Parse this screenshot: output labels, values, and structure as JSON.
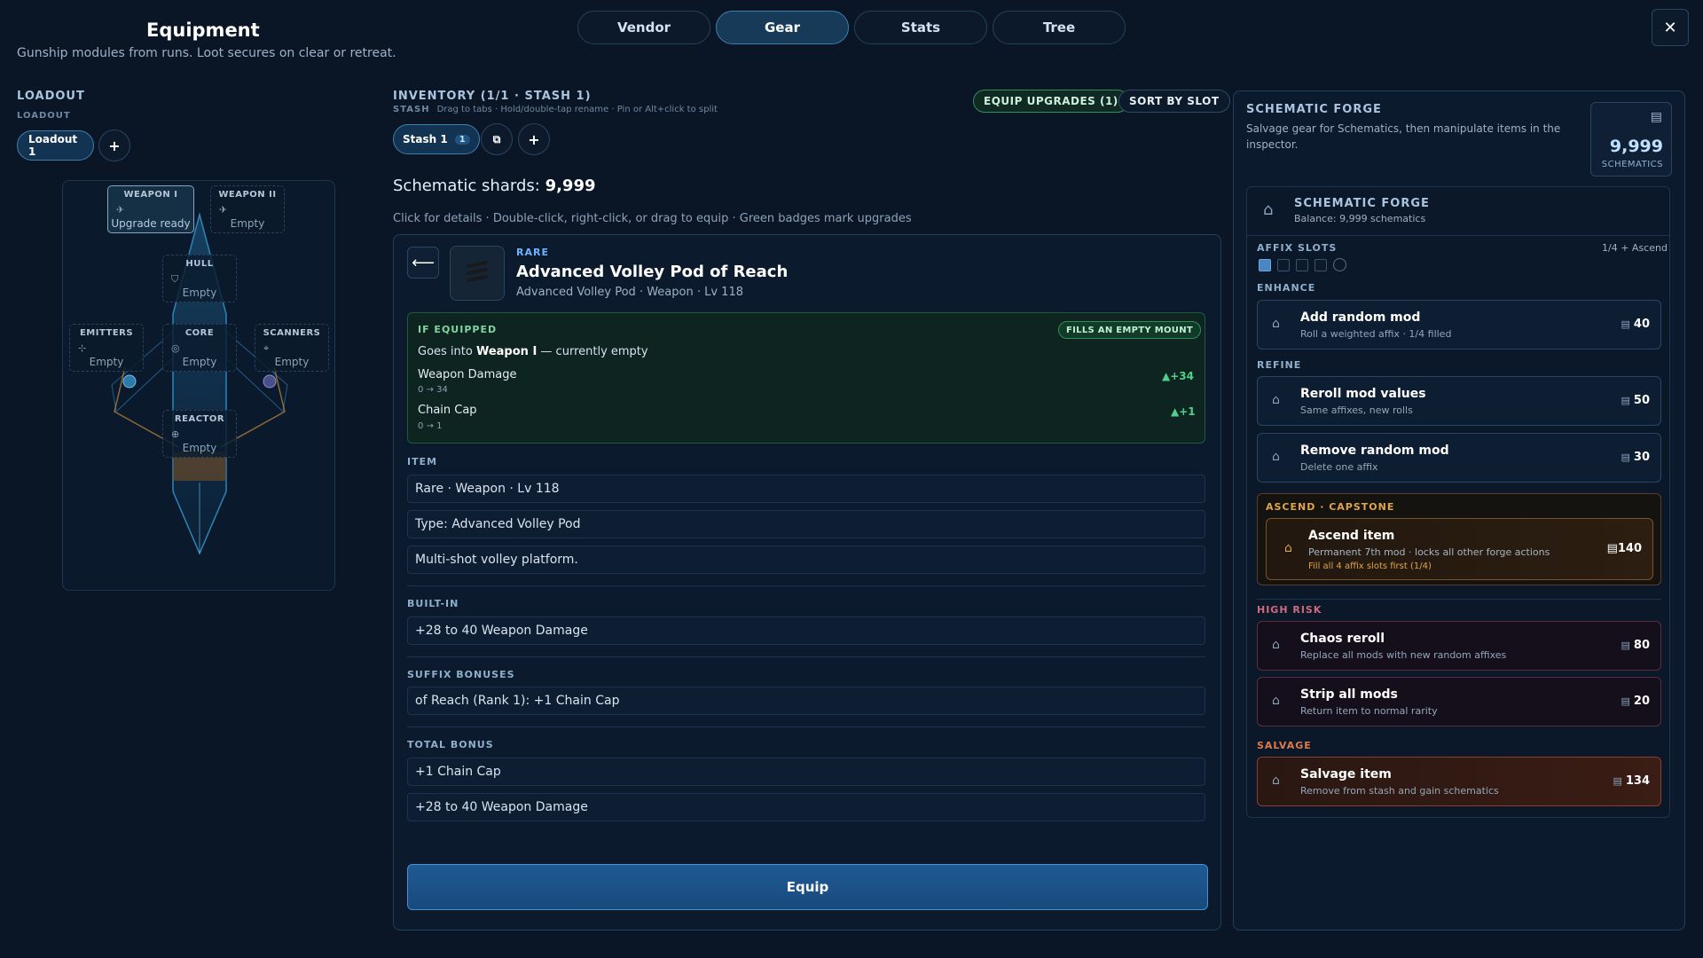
{
  "header": {
    "title": "Equipment",
    "subtitle": "Gunship modules from runs. Loot secures on clear or retreat.",
    "tabs": [
      {
        "label": "Vendor"
      },
      {
        "label": "Gear"
      },
      {
        "label": "Stats"
      },
      {
        "label": "Tree"
      }
    ],
    "active_tab": "Gear",
    "close_label": "✕"
  },
  "loadout": {
    "section_label": "LOADOUT",
    "sub_label": "LOADOUT",
    "active_loadout": "Loadout 1",
    "add_label": "+",
    "slots": [
      {
        "name": "WEAPON I",
        "status": "Upgrade ready",
        "icon": "weapon-icon"
      },
      {
        "name": "WEAPON II",
        "status": "Empty",
        "icon": "weapon-icon"
      },
      {
        "name": "HULL",
        "status": "Empty",
        "icon": "shield-icon"
      },
      {
        "name": "EMITTERS",
        "status": "Empty",
        "icon": "emitter-icon"
      },
      {
        "name": "CORE",
        "status": "Empty",
        "icon": "core-icon"
      },
      {
        "name": "SCANNERS",
        "status": "Empty",
        "icon": "scanner-icon"
      },
      {
        "name": "REACTOR",
        "status": "Empty",
        "icon": "reactor-icon"
      }
    ]
  },
  "inventory": {
    "title": "INVENTORY (1/1 · STASH 1)",
    "stash_label": "STASH",
    "stash_hint": "Drag to tabs · Hold/double-tap rename · Pin or Alt+click to split",
    "equip_upgrades_label": "EQUIP UPGRADES (1)",
    "sort_label": "SORT BY SLOT",
    "stash_tab_label": "Stash 1",
    "stash_tab_count": "1",
    "add_stash_label": "+",
    "shards_label": "Schematic shards:",
    "shards_value": "9,999",
    "help_text": "Click for details · Double-click, right-click, or drag to equip · Green badges mark upgrades"
  },
  "item": {
    "rarity": "RARE",
    "name": "Advanced Volley Pod of Reach",
    "subtitle": "Advanced Volley Pod · Weapon · Lv 118",
    "if_equipped": {
      "label": "IF EQUIPPED",
      "badge": "FILLS AN EMPTY MOUNT",
      "line_prefix": "Goes into ",
      "line_slot": "Weapon I",
      "line_suffix": " — currently empty",
      "stats": [
        {
          "name": "Weapon Damage",
          "change": "0 → 34",
          "delta": "+34"
        },
        {
          "name": "Chain Cap",
          "change": "0 → 1",
          "delta": "+1"
        }
      ]
    },
    "item_section": {
      "label": "ITEM",
      "rows": [
        "Rare · Weapon · Lv 118",
        "Type: Advanced Volley Pod",
        "Multi-shot volley platform."
      ]
    },
    "built_in": {
      "label": "BUILT-IN",
      "rows": [
        "+28 to 40 Weapon Damage"
      ]
    },
    "suffix": {
      "label": "SUFFIX BONUSES",
      "rows": [
        "of Reach (Rank 1): +1 Chain Cap"
      ]
    },
    "total": {
      "label": "TOTAL BONUS",
      "rows": [
        "+1 Chain Cap",
        "+28 to 40 Weapon Damage"
      ]
    },
    "equip_label": "Equip"
  },
  "forge": {
    "title": "SCHEMATIC FORGE",
    "description": "Salvage gear for Schematics, then manipulate items in the inspector.",
    "balance_value": "9,999",
    "balance_label": "SCHEMATICS",
    "inner_title": "SCHEMATIC FORGE",
    "inner_balance": "Balance: 9,999 schematics",
    "affix_label": "AFFIX SLOTS",
    "affix_status": "1/4 + Ascend",
    "affix_filled": 1,
    "affix_total": 4,
    "groups": {
      "enhance": "ENHANCE",
      "refine": "REFINE",
      "ascend": "ASCEND · CAPSTONE",
      "high_risk": "HIGH RISK",
      "salvage": "SALVAGE"
    },
    "actions": {
      "add_random_mod": {
        "title": "Add random mod",
        "desc": "Roll a weighted affix · 1/4 filled",
        "cost": "40"
      },
      "reroll_values": {
        "title": "Reroll mod values",
        "desc": "Same affixes, new rolls",
        "cost": "50"
      },
      "remove_random": {
        "title": "Remove random mod",
        "desc": "Delete one affix",
        "cost": "30"
      },
      "ascend": {
        "title": "Ascend item",
        "desc": "Permanent 7th mod · locks all other forge actions",
        "warning": "Fill all 4 affix slots first (1/4)",
        "cost": "140"
      },
      "chaos_reroll": {
        "title": "Chaos reroll",
        "desc": "Replace all mods with new random affixes",
        "cost": "80"
      },
      "strip_all": {
        "title": "Strip all mods",
        "desc": "Return item to normal rarity",
        "cost": "20"
      },
      "salvage": {
        "title": "Salvage item",
        "desc": "Remove from stash and gain schematics",
        "cost": "134"
      }
    }
  },
  "colors": {
    "background": "#0a1626",
    "accent": "#3f7fae",
    "rare": "#6fb4ff",
    "upgrade_green": "#4fd18a",
    "ascend": "#e0a44a",
    "salvage": "#c85a3a"
  }
}
